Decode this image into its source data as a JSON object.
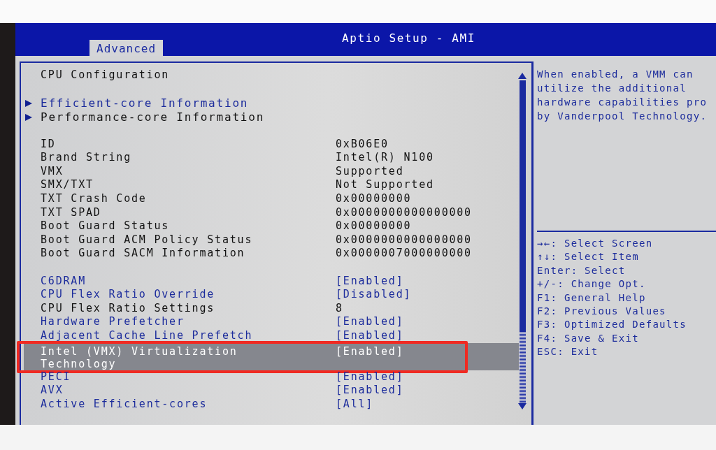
{
  "window": {
    "title": "Aptio Setup - AMI"
  },
  "tabs": [
    {
      "label": "Advanced",
      "selected": true
    }
  ],
  "heading": "CPU Configuration",
  "groups": [
    [
      {
        "kind": "submenu",
        "label": "Efficient-core Information",
        "selectable": true,
        "selected": false,
        "annotated": false
      },
      {
        "kind": "submenu",
        "label": "Performance-core Information",
        "selectable": false,
        "selected": false,
        "annotated": false
      }
    ],
    [
      {
        "kind": "info",
        "label": "ID",
        "value": "0xB06E0",
        "selectable": false,
        "selected": false,
        "annotated": false
      },
      {
        "kind": "info",
        "label": "Brand String",
        "value": "Intel(R) N100",
        "selectable": false,
        "selected": false,
        "annotated": false
      },
      {
        "kind": "info",
        "label": "VMX",
        "value": "Supported",
        "selectable": false,
        "selected": false,
        "annotated": false
      },
      {
        "kind": "info",
        "label": "SMX/TXT",
        "value": "Not Supported",
        "selectable": false,
        "selected": false,
        "annotated": false
      },
      {
        "kind": "info",
        "label": "TXT Crash Code",
        "value": "0x00000000",
        "selectable": false,
        "selected": false,
        "annotated": false
      },
      {
        "kind": "info",
        "label": "TXT SPAD",
        "value": "0x0000000000000000",
        "selectable": false,
        "selected": false,
        "annotated": false
      },
      {
        "kind": "info",
        "label": "Boot Guard Status",
        "value": "0x00000000",
        "selectable": false,
        "selected": false,
        "annotated": false
      },
      {
        "kind": "info",
        "label": "Boot Guard ACM Policy Status",
        "value": "0x0000000000000000",
        "selectable": false,
        "selected": false,
        "annotated": false
      },
      {
        "kind": "info",
        "label": "Boot Guard SACM Information",
        "value": "0x0000007000000000",
        "selectable": false,
        "selected": false,
        "annotated": false
      }
    ],
    [
      {
        "kind": "setting",
        "label": "C6DRAM",
        "value": "[Enabled]",
        "selectable": true,
        "selected": false,
        "annotated": false
      },
      {
        "kind": "setting",
        "label": "CPU Flex Ratio Override",
        "value": "[Disabled]",
        "selectable": true,
        "selected": false,
        "annotated": false
      },
      {
        "kind": "setting",
        "label": "CPU Flex Ratio Settings",
        "value": "8",
        "selectable": false,
        "selected": false,
        "annotated": false
      },
      {
        "kind": "setting",
        "label": "Hardware Prefetcher",
        "value": "[Enabled]",
        "selectable": true,
        "selected": false,
        "annotated": false
      },
      {
        "kind": "setting",
        "label": "Adjacent Cache Line Prefetch",
        "value": "[Enabled]",
        "selectable": true,
        "selected": false,
        "annotated": false
      },
      {
        "kind": "setting",
        "label": "Intel (VMX) Virtualization Technology",
        "value": "[Enabled]",
        "selectable": true,
        "selected": true,
        "annotated": true
      },
      {
        "kind": "setting",
        "label": "PECI",
        "value": "[Enabled]",
        "selectable": true,
        "selected": false,
        "annotated": false
      },
      {
        "kind": "setting",
        "label": "AVX",
        "value": "[Enabled]",
        "selectable": true,
        "selected": false,
        "annotated": false
      },
      {
        "kind": "setting",
        "label": "Active Efficient-cores",
        "value": "[All]",
        "selectable": true,
        "selected": false,
        "annotated": false
      }
    ]
  ],
  "help": [
    "When enabled, a VMM can",
    "utilize the additional",
    "hardware capabilities pro",
    "by Vanderpool Technology."
  ],
  "keys": [
    "→←: Select Screen",
    "↑↓: Select Item",
    "Enter: Select",
    "+/-: Change Opt.",
    "F1: General Help",
    "F2: Previous Values",
    "F3: Optimized Defaults",
    "F4: Save & Exit",
    "ESC: Exit"
  ]
}
